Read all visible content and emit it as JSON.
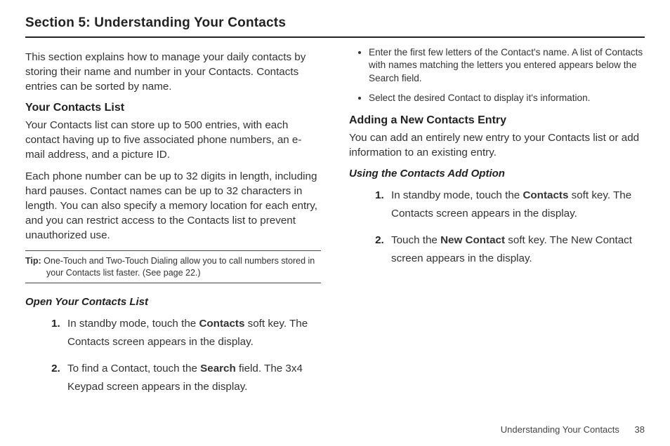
{
  "section_title": "Section 5: Understanding Your Contacts",
  "left": {
    "intro": "This section explains how to manage your daily contacts by storing their name and number in your Contacts. Contacts entries can be sorted by name.",
    "h2": "Your Contacts List",
    "p1": "Your Contacts list can store up to 500 entries, with each contact having up to five associated phone numbers, an e-mail address, and a picture ID.",
    "p2": "Each phone number can be up to 32 digits in length, including hard pauses. Contact names can be up to 32 characters in length. You can also specify a memory location for each entry, and you can restrict access to the Contacts list to prevent unauthorized use.",
    "tip_label": "Tip:",
    "tip_text_line1": " One-Touch and Two-Touch Dialing allow you to call numbers stored in",
    "tip_text_line2": "your Contacts list faster. (See page 22.)",
    "h3": "Open Your Contacts List",
    "step1_a": "In standby mode, touch the ",
    "step1_b": "Contacts",
    "step1_c": " soft key. The Contacts screen appears in the display.",
    "step2_a": "To find a Contact, touch the ",
    "step2_b": "Search",
    "step2_c": " field. The 3x4 Keypad screen appears in the display."
  },
  "right": {
    "bullet1": "Enter the first few letters of the Contact's name. A list of Contacts with names matching the letters you entered appears below the Search field.",
    "bullet2": "Select the desired Contact to display it's information.",
    "h2": "Adding a New Contacts Entry",
    "p1": "You can add an entirely new entry to your Contacts list or add information to an existing entry.",
    "h3": "Using the Contacts Add Option",
    "step1_a": "In standby mode, touch the ",
    "step1_b": "Contacts",
    "step1_c": " soft key. The Contacts screen appears in the display.",
    "step2_a": "Touch the ",
    "step2_b": "New Contact",
    "step2_c": " soft key. The New Contact screen appears in the display."
  },
  "footer": {
    "text": "Understanding Your Contacts",
    "page": "38"
  }
}
